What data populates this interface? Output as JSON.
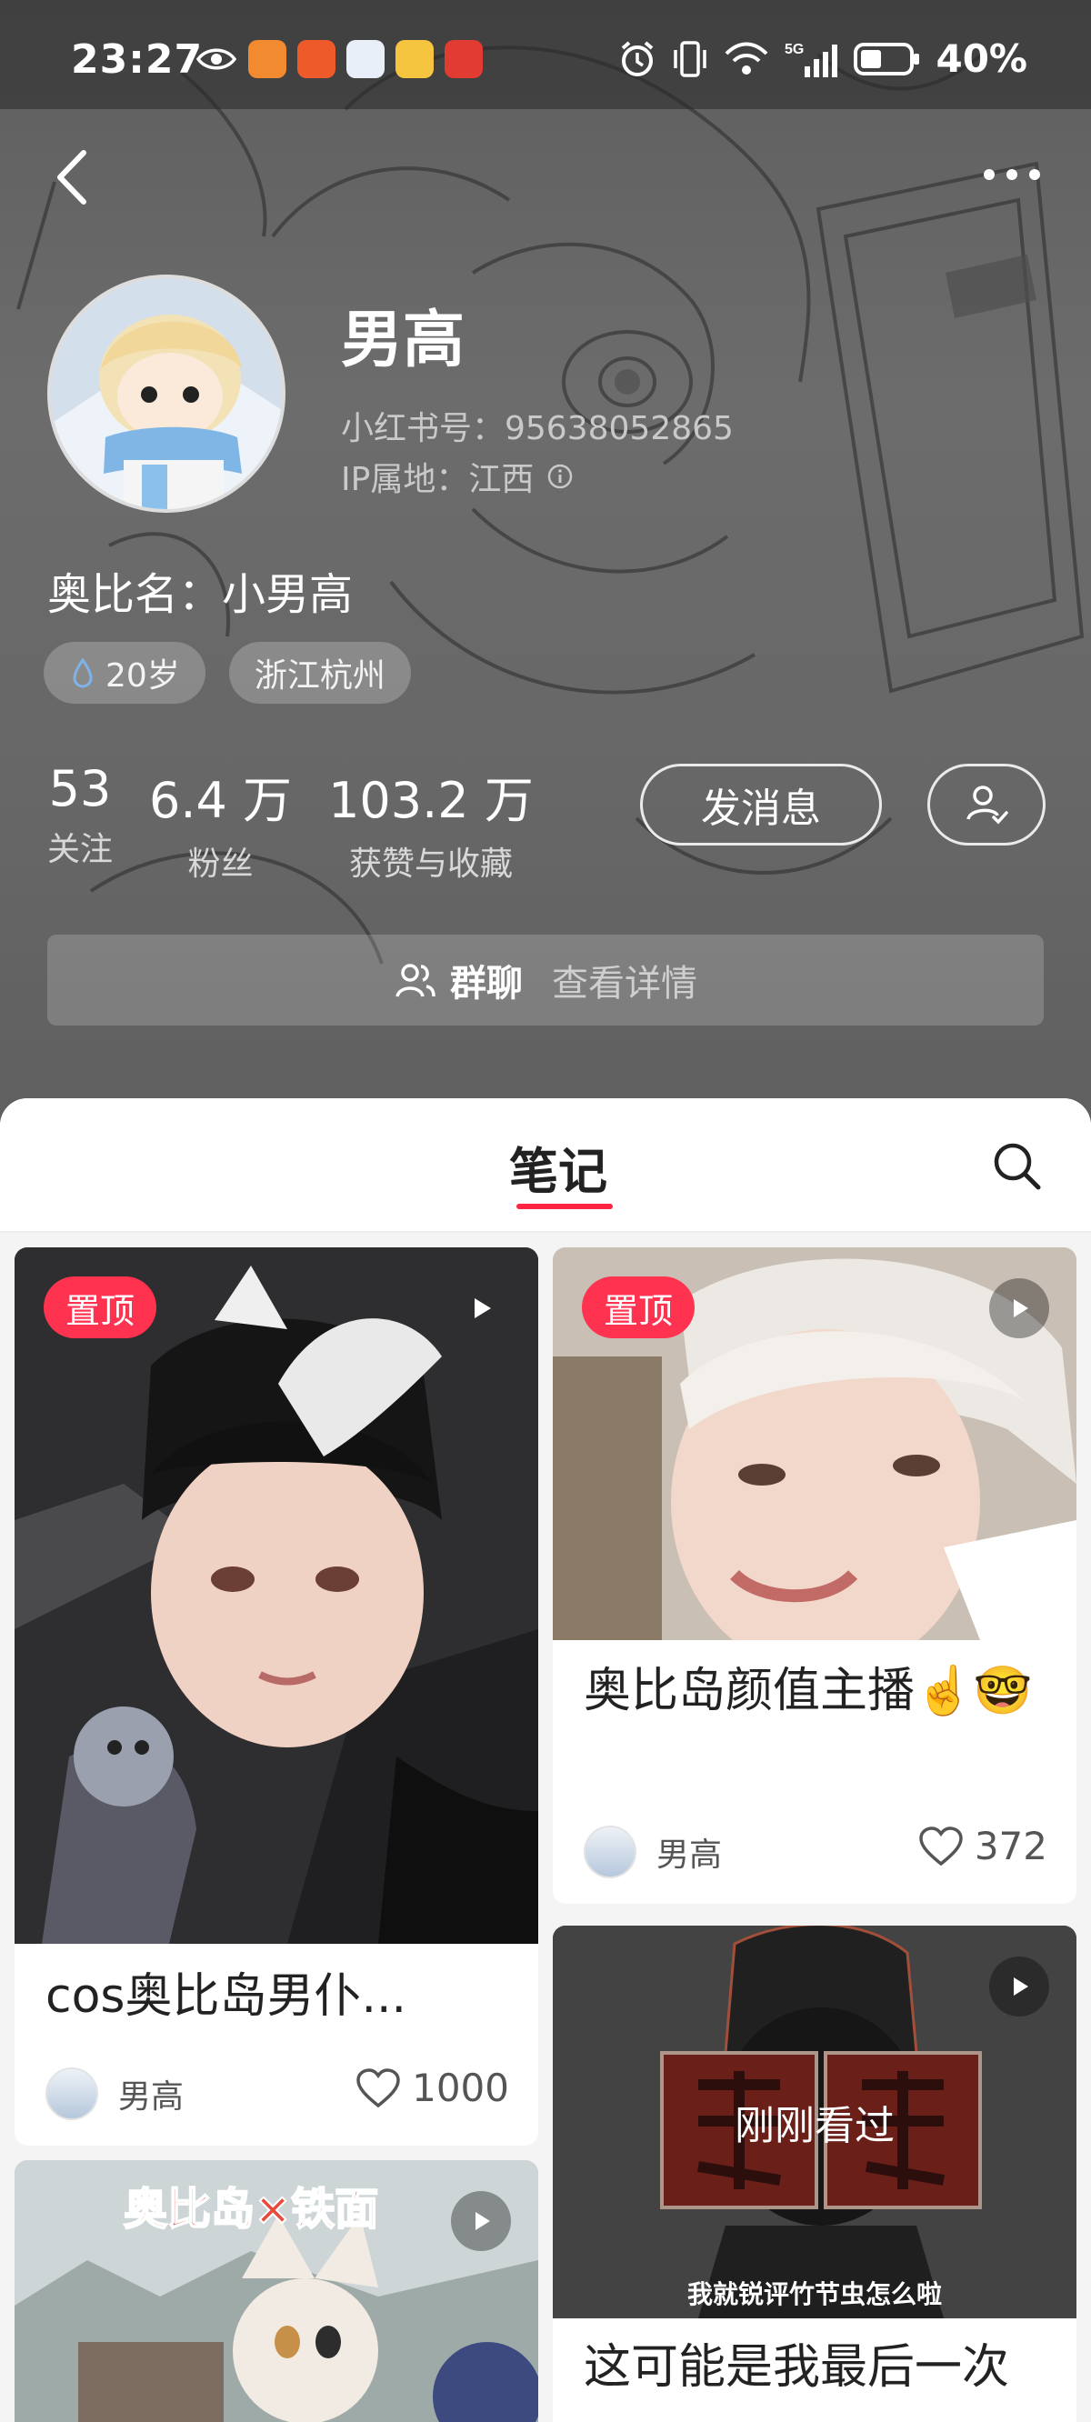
{
  "status_bar": {
    "time": "23:27",
    "network": "5G",
    "battery": "40%",
    "colors": {
      "app1": "#f28b30",
      "app2": "#ee5a2a",
      "app3": "#e9eff8",
      "app4": "#f5c53f",
      "app5": "#e23b32"
    }
  },
  "nav": {
    "back_icon": "chevron-left-icon",
    "more_icon": "more-dots-icon"
  },
  "profile": {
    "name": "男高",
    "red_id": "小红书号：95638052865",
    "ip_location": "IP属地：江西",
    "bio": "奥比名：小男高",
    "tags": [
      "20岁",
      "浙江杭州"
    ]
  },
  "stats": [
    {
      "num": "53",
      "label": "关注"
    },
    {
      "num": "6.4 万",
      "label": "粉丝"
    },
    {
      "num": "103.2 万",
      "label": "获赞与收藏"
    }
  ],
  "actions": {
    "message_label": "发消息",
    "follow_icon": "user-check-icon"
  },
  "group_chat": {
    "title": "群聊",
    "detail": "查看详情"
  },
  "tabs": {
    "notes_label": "笔记",
    "accent": "#ff2442"
  },
  "notes": [
    {
      "pin": "置顶",
      "title": "cos奥比岛男仆...",
      "author": "男高",
      "likes": "1000"
    },
    {
      "pin": "置顶",
      "title": "奥比岛颜值主播☝️🤓",
      "author": "男高",
      "likes": "372"
    },
    {
      "cover_text": "奥比岛×铁面"
    },
    {
      "cover_text": "锐评",
      "cover_caption": "我就锐评竹节虫怎么啦",
      "overlay": "刚刚看过",
      "title": "这可能是我最后一次"
    }
  ]
}
